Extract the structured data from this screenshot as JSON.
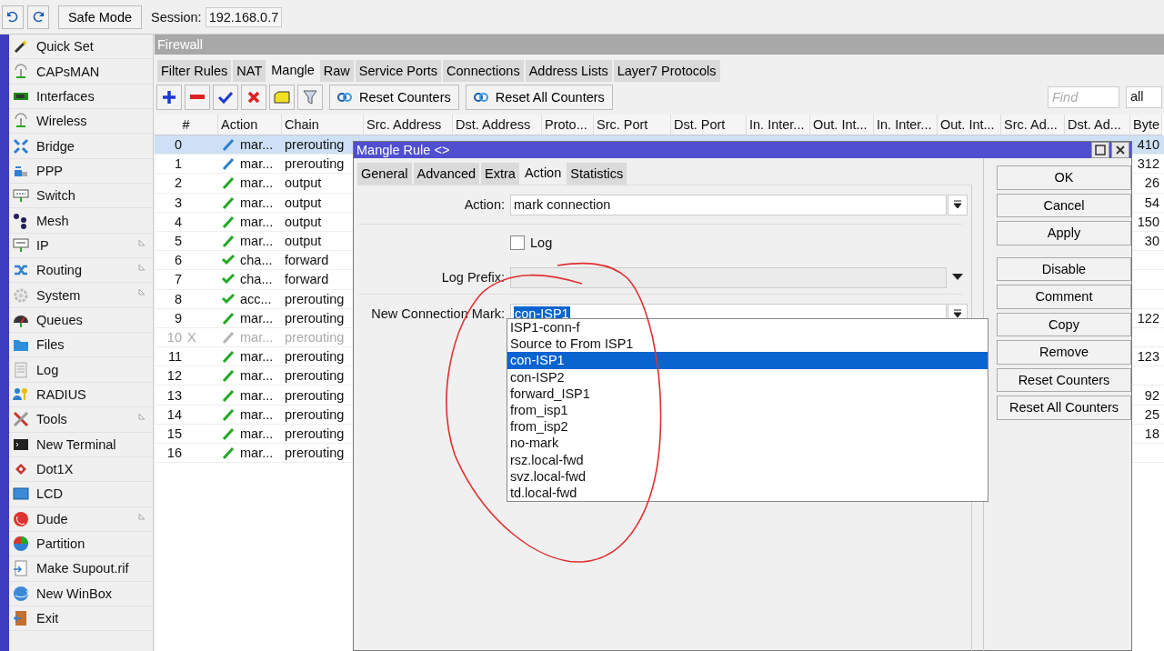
{
  "topbar": {
    "safe_mode": "Safe Mode",
    "session_label": "Session:",
    "session_value": "192.168.0.7"
  },
  "sidebar": {
    "items": [
      {
        "label": "Quick Set",
        "submenu": false
      },
      {
        "label": "CAPsMAN",
        "submenu": false
      },
      {
        "label": "Interfaces",
        "submenu": false
      },
      {
        "label": "Wireless",
        "submenu": false
      },
      {
        "label": "Bridge",
        "submenu": false
      },
      {
        "label": "PPP",
        "submenu": false
      },
      {
        "label": "Switch",
        "submenu": false
      },
      {
        "label": "Mesh",
        "submenu": false
      },
      {
        "label": "IP",
        "submenu": true
      },
      {
        "label": "Routing",
        "submenu": true
      },
      {
        "label": "System",
        "submenu": true
      },
      {
        "label": "Queues",
        "submenu": false
      },
      {
        "label": "Files",
        "submenu": false
      },
      {
        "label": "Log",
        "submenu": false
      },
      {
        "label": "RADIUS",
        "submenu": false
      },
      {
        "label": "Tools",
        "submenu": true
      },
      {
        "label": "New Terminal",
        "submenu": false
      },
      {
        "label": "Dot1X",
        "submenu": false
      },
      {
        "label": "LCD",
        "submenu": false
      },
      {
        "label": "Dude",
        "submenu": true
      },
      {
        "label": "Partition",
        "submenu": false
      },
      {
        "label": "Make Supout.rif",
        "submenu": false
      },
      {
        "label": "New WinBox",
        "submenu": false
      },
      {
        "label": "Exit",
        "submenu": false
      }
    ]
  },
  "firewall": {
    "title": "Firewall",
    "tabs": [
      {
        "label": "Filter Rules",
        "selected": false
      },
      {
        "label": "NAT",
        "selected": false
      },
      {
        "label": "Mangle",
        "selected": true
      },
      {
        "label": "Raw",
        "selected": false
      },
      {
        "label": "Service Ports",
        "selected": false
      },
      {
        "label": "Connections",
        "selected": false
      },
      {
        "label": "Address Lists",
        "selected": false
      },
      {
        "label": "Layer7 Protocols",
        "selected": false
      }
    ],
    "toolbar": {
      "buttons": [
        "Reset Counters",
        "Reset All Counters"
      ],
      "find": {
        "placeholder": "Find"
      },
      "filter": "all"
    },
    "table": {
      "columns": [
        "#",
        "Action",
        "Chain",
        "Src. Address",
        "Dst. Address",
        "Proto...",
        "Src. Port",
        "Dst. Port",
        "In. Inter...",
        "Out. Int...",
        "In. Inter...",
        "Out. Int...",
        "Src. Ad...",
        "Dst. Ad...",
        "Byte"
      ],
      "rows": [
        {
          "number": "0",
          "flag": "",
          "action": "mar...",
          "kind": "mark",
          "color": "#2f7fd0",
          "chain": "prerouting",
          "bytes": "410",
          "selected": true,
          "disabled": false
        },
        {
          "number": "1",
          "flag": "",
          "action": "mar...",
          "kind": "mark",
          "color": "#2f7fd0",
          "chain": "prerouting",
          "bytes": "312",
          "selected": false,
          "disabled": false
        },
        {
          "number": "2",
          "flag": "",
          "action": "mar...",
          "kind": "mark",
          "color": "#22a822",
          "chain": "output",
          "bytes": "26",
          "selected": false,
          "disabled": false
        },
        {
          "number": "3",
          "flag": "",
          "action": "mar...",
          "kind": "mark",
          "color": "#22a822",
          "chain": "output",
          "bytes": "54",
          "selected": false,
          "disabled": false
        },
        {
          "number": "4",
          "flag": "",
          "action": "mar...",
          "kind": "mark",
          "color": "#22a822",
          "chain": "output",
          "bytes": "150",
          "selected": false,
          "disabled": false
        },
        {
          "number": "5",
          "flag": "",
          "action": "mar...",
          "kind": "mark",
          "color": "#22a822",
          "chain": "output",
          "bytes": "30",
          "selected": false,
          "disabled": false
        },
        {
          "number": "6",
          "flag": "",
          "action": "cha...",
          "kind": "accept",
          "color": "#22a822",
          "chain": "forward",
          "bytes": "",
          "selected": false,
          "disabled": false
        },
        {
          "number": "7",
          "flag": "",
          "action": "cha...",
          "kind": "accept",
          "color": "#22a822",
          "chain": "forward",
          "bytes": "",
          "selected": false,
          "disabled": false
        },
        {
          "number": "8",
          "flag": "",
          "action": "acc...",
          "kind": "accept",
          "color": "#22a822",
          "chain": "prerouting",
          "bytes": "",
          "selected": false,
          "disabled": false
        },
        {
          "number": "9",
          "flag": "",
          "action": "mar...",
          "kind": "mark",
          "color": "#22a822",
          "chain": "prerouting",
          "bytes": "122",
          "selected": false,
          "disabled": false
        },
        {
          "number": "10",
          "flag": "X",
          "action": "mar...",
          "kind": "mark",
          "color": "#b4b4b4",
          "chain": "prerouting",
          "bytes": "",
          "selected": false,
          "disabled": true
        },
        {
          "number": "11",
          "flag": "",
          "action": "mar...",
          "kind": "mark",
          "color": "#22a822",
          "chain": "prerouting",
          "bytes": "123",
          "selected": false,
          "disabled": false
        },
        {
          "number": "12",
          "flag": "",
          "action": "mar...",
          "kind": "mark",
          "color": "#22a822",
          "chain": "prerouting",
          "bytes": "",
          "selected": false,
          "disabled": false
        },
        {
          "number": "13",
          "flag": "",
          "action": "mar...",
          "kind": "mark",
          "color": "#22a822",
          "chain": "prerouting",
          "bytes": "92",
          "selected": false,
          "disabled": false
        },
        {
          "number": "14",
          "flag": "",
          "action": "mar...",
          "kind": "mark",
          "color": "#22a822",
          "chain": "prerouting",
          "bytes": "25",
          "selected": false,
          "disabled": false
        },
        {
          "number": "15",
          "flag": "",
          "action": "mar...",
          "kind": "mark",
          "color": "#22a822",
          "chain": "prerouting",
          "bytes": "18",
          "selected": false,
          "disabled": false
        },
        {
          "number": "16",
          "flag": "",
          "action": "mar...",
          "kind": "mark",
          "color": "#22a822",
          "chain": "prerouting",
          "bytes": "",
          "selected": false,
          "disabled": false
        }
      ]
    }
  },
  "dialog": {
    "title": "Mangle Rule <>",
    "tabs": [
      {
        "label": "General",
        "selected": false
      },
      {
        "label": "Advanced",
        "selected": false
      },
      {
        "label": "Extra",
        "selected": false
      },
      {
        "label": "Action",
        "selected": true
      },
      {
        "label": "Statistics",
        "selected": false
      }
    ],
    "action": {
      "label": "Action:",
      "value": "mark connection"
    },
    "log": {
      "label": "Log",
      "checked": false
    },
    "log_prefix": {
      "label": "Log Prefix:"
    },
    "new_connection_mark": {
      "label": "New Connection Mark:",
      "value": "con-ISP1",
      "expanded": true,
      "options": [
        {
          "label": "ISP1-conn-f",
          "selected": false
        },
        {
          "label": "Source to From ISP1",
          "selected": false
        },
        {
          "label": "con-ISP1",
          "selected": true
        },
        {
          "label": "con-ISP2",
          "selected": false
        },
        {
          "label": "forward_ISP1",
          "selected": false
        },
        {
          "label": "from_isp1",
          "selected": false
        },
        {
          "label": "from_isp2",
          "selected": false
        },
        {
          "label": "no-mark",
          "selected": false
        },
        {
          "label": "rsz.local-fwd",
          "selected": false
        },
        {
          "label": "svz.local-fwd",
          "selected": false
        },
        {
          "label": "td.local-fwd",
          "selected": false
        }
      ]
    },
    "primary_buttons": [
      "OK",
      "Cancel",
      "Apply"
    ],
    "secondary_buttons": [
      "Disable",
      "Comment",
      "Copy",
      "Remove",
      "Reset Counters",
      "Reset All Counters"
    ]
  }
}
